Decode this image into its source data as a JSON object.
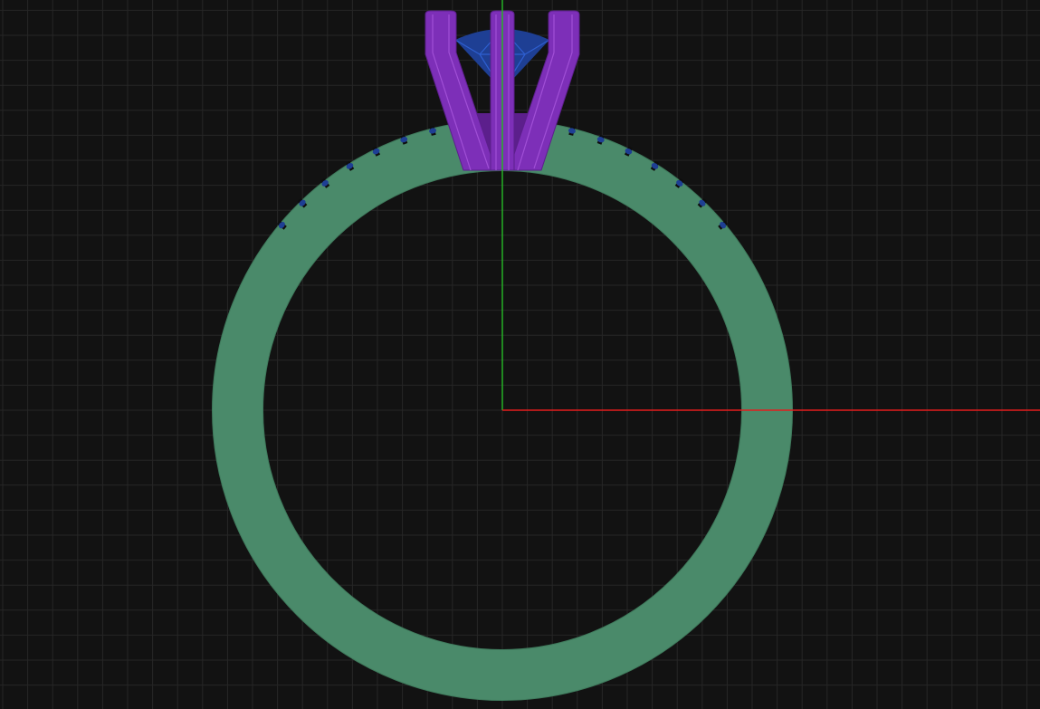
{
  "viewport": {
    "view": "front",
    "background_color": "#121212",
    "grid_color": "#262626",
    "axes": {
      "x_axis_color": "#e41d1d",
      "y_axis_color": "#25b025"
    }
  },
  "model": {
    "band": {
      "color": "#4a8a6a",
      "edge_color": "#3f7a5c"
    },
    "prongs": {
      "count": 4,
      "color": "#7d2fb8",
      "highlight_color": "#a04fd6",
      "shadow_color": "#5c1f8c"
    },
    "center_stone": {
      "color": "#1e3f94",
      "facet_color": "#2e5fd0"
    },
    "accent_stones": {
      "color": "#1e3f94",
      "notch_color": "#0e0e0e"
    }
  }
}
